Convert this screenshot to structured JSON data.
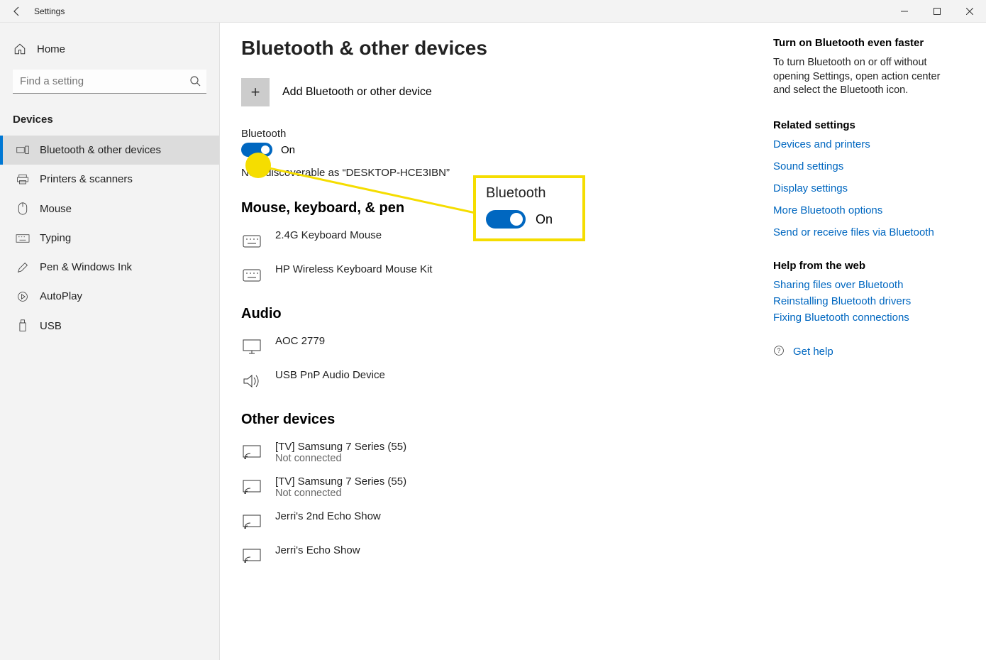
{
  "window": {
    "title": "Settings"
  },
  "sidebar": {
    "home": "Home",
    "search_placeholder": "Find a setting",
    "category": "Devices",
    "items": [
      {
        "label": "Bluetooth & other devices"
      },
      {
        "label": "Printers & scanners"
      },
      {
        "label": "Mouse"
      },
      {
        "label": "Typing"
      },
      {
        "label": "Pen & Windows Ink"
      },
      {
        "label": "AutoPlay"
      },
      {
        "label": "USB"
      }
    ]
  },
  "page": {
    "title": "Bluetooth & other devices",
    "add_label": "Add Bluetooth or other device",
    "bt_label": "Bluetooth",
    "bt_state": "On",
    "discoverable": "Now discoverable as “DESKTOP-HCE3IBN”",
    "groups": [
      {
        "title": "Mouse, keyboard, & pen",
        "items": [
          {
            "name": "2.4G Keyboard Mouse",
            "status": "",
            "icon": "keyboard"
          },
          {
            "name": "HP Wireless Keyboard Mouse Kit",
            "status": "",
            "icon": "keyboard"
          }
        ]
      },
      {
        "title": "Audio",
        "items": [
          {
            "name": "AOC 2779",
            "status": "",
            "icon": "monitor"
          },
          {
            "name": "USB PnP Audio Device",
            "status": "",
            "icon": "speaker"
          }
        ]
      },
      {
        "title": "Other devices",
        "items": [
          {
            "name": "[TV] Samsung 7 Series (55)",
            "status": "Not connected",
            "icon": "cast"
          },
          {
            "name": "[TV] Samsung 7 Series (55)",
            "status": "Not connected",
            "icon": "cast"
          },
          {
            "name": "Jerri's 2nd Echo Show",
            "status": "",
            "icon": "cast"
          },
          {
            "name": "Jerri's Echo Show",
            "status": "",
            "icon": "cast"
          }
        ]
      }
    ]
  },
  "right": {
    "faster_title": "Turn on Bluetooth even faster",
    "faster_text": "To turn Bluetooth on or off without opening Settings, open action center and select the Bluetooth icon.",
    "related_title": "Related settings",
    "related_links": [
      "Devices and printers",
      "Sound settings",
      "Display settings",
      "More Bluetooth options",
      "Send or receive files via Bluetooth"
    ],
    "help_title": "Help from the web",
    "help_links": [
      "Sharing files over Bluetooth",
      "Reinstalling Bluetooth drivers",
      "Fixing Bluetooth connections"
    ],
    "get_help": "Get help"
  },
  "callout": {
    "label": "Bluetooth",
    "state": "On"
  }
}
